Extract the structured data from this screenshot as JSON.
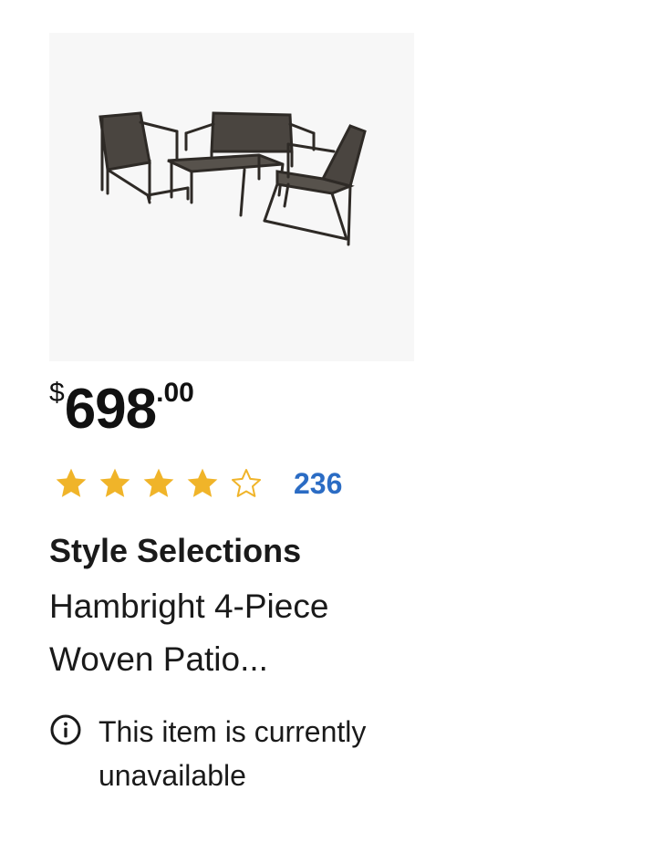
{
  "product": {
    "image_alt": "Patio furniture set",
    "price": {
      "currency": "$",
      "whole": "698",
      "cents": ".00"
    },
    "rating": {
      "stars": 4,
      "max_stars": 5,
      "count": "236",
      "star_color": "#f0b429",
      "count_color": "#2b6cc4"
    },
    "brand": "Style Selections",
    "title": "Hambright 4-Piece Woven Patio...",
    "availability": "This item is currently unavailable"
  }
}
